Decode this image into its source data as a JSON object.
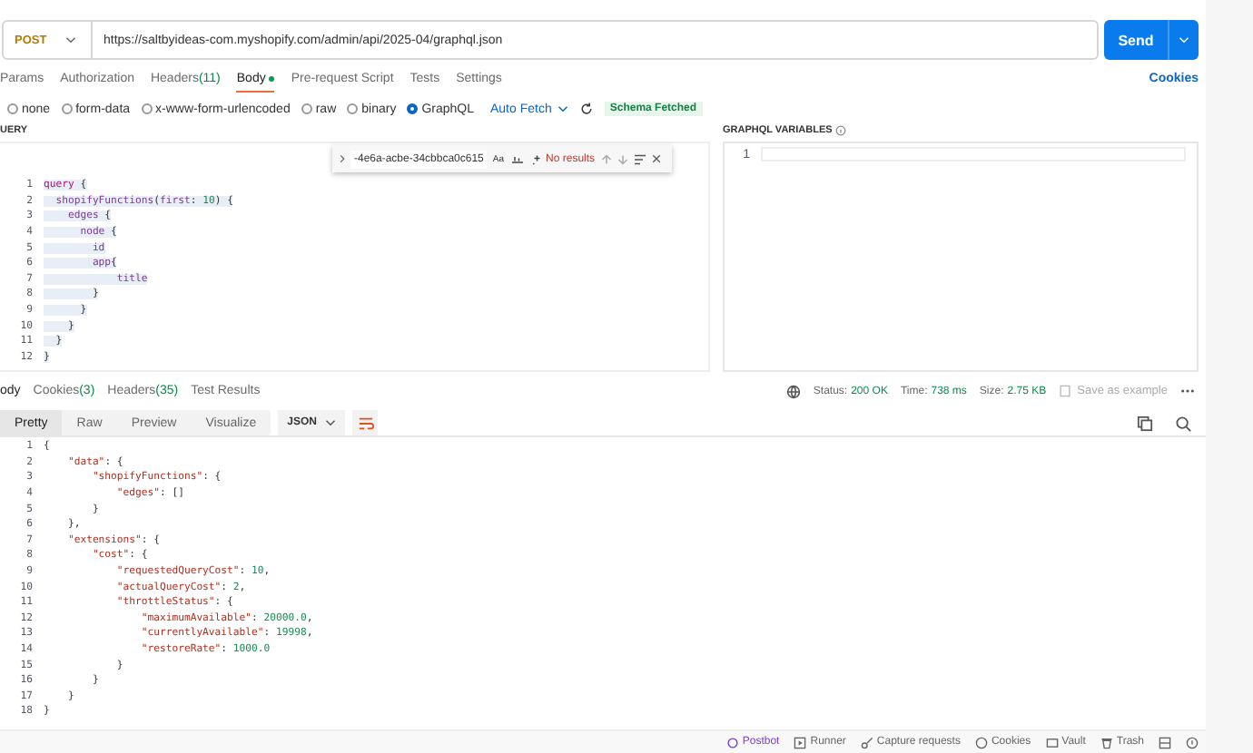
{
  "request": {
    "method": "POST",
    "url": "https://saltbyideas-com.myshopify.com/admin/api/2025-04/graphql.json",
    "send": "Send"
  },
  "request_tabs": [
    {
      "label": "Params",
      "selected": false,
      "dot": false
    },
    {
      "label": "Authorization",
      "selected": false,
      "dot": false
    },
    {
      "label": "Headers",
      "count": "(11)",
      "selected": false,
      "dot": false
    },
    {
      "label": "Body",
      "selected": true,
      "dot": true
    },
    {
      "label": "Pre-request Script",
      "selected": false,
      "dot": false
    },
    {
      "label": "Tests",
      "selected": false,
      "dot": false
    },
    {
      "label": "Settings",
      "selected": false,
      "dot": false
    }
  ],
  "cookies_link": "Cookies",
  "body_types": [
    {
      "label": "none",
      "selected": false
    },
    {
      "label": "form-data",
      "selected": false
    },
    {
      "label": "x-www-form-urlencoded",
      "selected": false
    },
    {
      "label": "raw",
      "selected": false
    },
    {
      "label": "binary",
      "selected": false
    },
    {
      "label": "GraphQL",
      "selected": true
    }
  ],
  "auto_fetch": "Auto Fetch",
  "schema_badge": "Schema Fetched",
  "query_panel": {
    "title": "UERY",
    "find": {
      "value": "-4e6a-acbe-34cbbca0c615",
      "match_case": "Aa",
      "result": "No results"
    },
    "lines": [
      {
        "n": "1",
        "tokens": [
          {
            "t": "query",
            "kind": "kw"
          },
          {
            "t": " {",
            "kind": "punc"
          }
        ]
      },
      {
        "n": "2",
        "tokens": [
          {
            "t": "  shopifyFunctions",
            "kind": "field"
          },
          {
            "t": "(",
            "kind": "punc"
          },
          {
            "t": "first",
            "kind": "field"
          },
          {
            "t": ": ",
            "kind": "punc"
          },
          {
            "t": "10",
            "kind": "num"
          },
          {
            "t": ") {",
            "kind": "punc"
          }
        ]
      },
      {
        "n": "3",
        "tokens": [
          {
            "t": "    edges",
            "kind": "field"
          },
          {
            "t": " {",
            "kind": "punc"
          }
        ]
      },
      {
        "n": "4",
        "tokens": [
          {
            "t": "      node",
            "kind": "field"
          },
          {
            "t": " {",
            "kind": "punc"
          }
        ]
      },
      {
        "n": "5",
        "tokens": [
          {
            "t": "        id",
            "kind": "field"
          }
        ]
      },
      {
        "n": "6",
        "tokens": [
          {
            "t": "        app",
            "kind": "field"
          },
          {
            "t": "{",
            "kind": "punc"
          }
        ]
      },
      {
        "n": "7",
        "tokens": [
          {
            "t": "            title",
            "kind": "field"
          }
        ]
      },
      {
        "n": "8",
        "tokens": [
          {
            "t": "        }",
            "kind": "punc"
          }
        ]
      },
      {
        "n": "9",
        "tokens": [
          {
            "t": "      }",
            "kind": "punc"
          }
        ]
      },
      {
        "n": "10",
        "tokens": [
          {
            "t": "    }",
            "kind": "punc"
          }
        ]
      },
      {
        "n": "11",
        "tokens": [
          {
            "t": "  }",
            "kind": "punc"
          }
        ]
      },
      {
        "n": "12",
        "tokens": [
          {
            "t": "}",
            "kind": "punc"
          }
        ]
      }
    ]
  },
  "variables_panel": {
    "title": "GRAPHQL VARIABLES",
    "lines": [
      {
        "n": "1"
      }
    ]
  },
  "response_tabs": [
    {
      "label": "ody",
      "selected": true
    },
    {
      "label": "Cookies",
      "count": "(3)",
      "selected": false
    },
    {
      "label": "Headers",
      "count": "(35)",
      "selected": false
    },
    {
      "label": "Test Results",
      "selected": false
    }
  ],
  "status": {
    "status_label": "Status:",
    "status": "200 OK",
    "time_label": "Time:",
    "time": "738 ms",
    "size_label": "Size:",
    "size": "2.75 KB",
    "save": "Save as example"
  },
  "view_modes": [
    {
      "label": "Pretty",
      "selected": true
    },
    {
      "label": "Raw",
      "selected": false
    },
    {
      "label": "Preview",
      "selected": false
    },
    {
      "label": "Visualize",
      "selected": false
    }
  ],
  "format": "JSON",
  "response_lines": [
    {
      "n": "1",
      "tokens": [
        {
          "t": "{",
          "kind": "punc"
        }
      ]
    },
    {
      "n": "2",
      "tokens": [
        {
          "t": "    \"data\"",
          "kind": "key"
        },
        {
          "t": ": {",
          "kind": "punc"
        }
      ]
    },
    {
      "n": "3",
      "tokens": [
        {
          "t": "        \"shopifyFunctions\"",
          "kind": "key"
        },
        {
          "t": ": {",
          "kind": "punc"
        }
      ]
    },
    {
      "n": "4",
      "tokens": [
        {
          "t": "            \"edges\"",
          "kind": "key"
        },
        {
          "t": ": []",
          "kind": "punc"
        }
      ]
    },
    {
      "n": "5",
      "tokens": [
        {
          "t": "        }",
          "kind": "punc"
        }
      ]
    },
    {
      "n": "6",
      "tokens": [
        {
          "t": "    },",
          "kind": "punc"
        }
      ]
    },
    {
      "n": "7",
      "tokens": [
        {
          "t": "    \"extensions\"",
          "kind": "key"
        },
        {
          "t": ": {",
          "kind": "punc"
        }
      ]
    },
    {
      "n": "8",
      "tokens": [
        {
          "t": "        \"cost\"",
          "kind": "key"
        },
        {
          "t": ": {",
          "kind": "punc"
        }
      ]
    },
    {
      "n": "9",
      "tokens": [
        {
          "t": "            \"requestedQueryCost\"",
          "kind": "key"
        },
        {
          "t": ": ",
          "kind": "punc"
        },
        {
          "t": "10",
          "kind": "num"
        },
        {
          "t": ",",
          "kind": "punc"
        }
      ]
    },
    {
      "n": "10",
      "tokens": [
        {
          "t": "            \"actualQueryCost\"",
          "kind": "key"
        },
        {
          "t": ": ",
          "kind": "punc"
        },
        {
          "t": "2",
          "kind": "num"
        },
        {
          "t": ",",
          "kind": "punc"
        }
      ]
    },
    {
      "n": "11",
      "tokens": [
        {
          "t": "            \"throttleStatus\"",
          "kind": "key"
        },
        {
          "t": ": {",
          "kind": "punc"
        }
      ]
    },
    {
      "n": "12",
      "tokens": [
        {
          "t": "                \"maximumAvailable\"",
          "kind": "key"
        },
        {
          "t": ": ",
          "kind": "punc"
        },
        {
          "t": "20000.0",
          "kind": "num"
        },
        {
          "t": ",",
          "kind": "punc"
        }
      ]
    },
    {
      "n": "13",
      "tokens": [
        {
          "t": "                \"currentlyAvailable\"",
          "kind": "key"
        },
        {
          "t": ": ",
          "kind": "punc"
        },
        {
          "t": "19998",
          "kind": "num"
        },
        {
          "t": ",",
          "kind": "punc"
        }
      ]
    },
    {
      "n": "14",
      "tokens": [
        {
          "t": "                \"restoreRate\"",
          "kind": "key"
        },
        {
          "t": ": ",
          "kind": "punc"
        },
        {
          "t": "1000.0",
          "kind": "num"
        }
      ]
    },
    {
      "n": "15",
      "tokens": [
        {
          "t": "            }",
          "kind": "punc"
        }
      ]
    },
    {
      "n": "16",
      "tokens": [
        {
          "t": "        }",
          "kind": "punc"
        }
      ]
    },
    {
      "n": "17",
      "tokens": [
        {
          "t": "    }",
          "kind": "punc"
        }
      ]
    },
    {
      "n": "18",
      "tokens": [
        {
          "t": "}",
          "kind": "punc"
        }
      ]
    }
  ],
  "status_bar": [
    {
      "label": "Postbot",
      "kind": "postbot"
    },
    {
      "label": "Runner",
      "kind": "runner"
    },
    {
      "label": "Capture requests",
      "kind": "capture"
    },
    {
      "label": "Cookies",
      "kind": "cookies"
    },
    {
      "label": "Vault",
      "kind": "vault"
    },
    {
      "label": "Trash",
      "kind": "trash"
    }
  ]
}
